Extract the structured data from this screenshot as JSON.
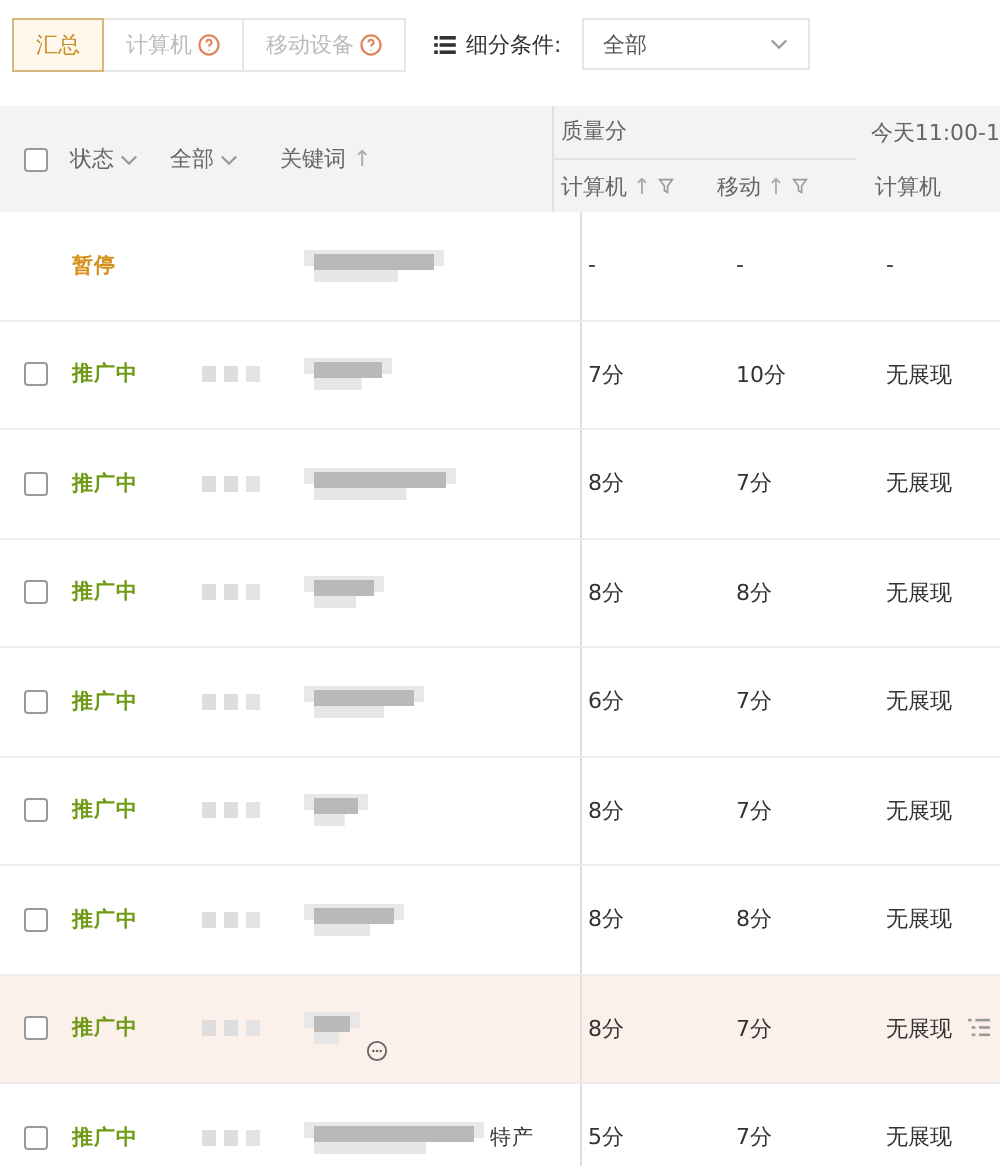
{
  "tabs": [
    {
      "label": "汇总",
      "selected": true,
      "help": false
    },
    {
      "label": "计算机",
      "selected": false,
      "help": true
    },
    {
      "label": "移动设备",
      "selected": false,
      "help": true
    }
  ],
  "filter": {
    "label": "细分条件:",
    "value": "全部"
  },
  "table": {
    "header": {
      "checked": false,
      "status": "状态",
      "scope": "全部",
      "keyword": "关键词",
      "keyword_sort": "↑",
      "group_1": "质量分",
      "group_2": "今天11:00-1",
      "columns": [
        {
          "label": "计算机",
          "sort": "↑",
          "filter": true
        },
        {
          "label": "移动",
          "sort": "↑",
          "filter": true
        },
        {
          "label": "计算机",
          "filter": false
        }
      ]
    },
    "rows": [
      {
        "kind": "paused",
        "status": "暂停",
        "computer": "-",
        "mobile": "-",
        "today": "-",
        "highlighted": false
      },
      {
        "kind": "active",
        "status": "推广中",
        "checked": false,
        "computer": "7分",
        "mobile": "10分",
        "today": "无展现",
        "highlighted": false
      },
      {
        "kind": "active",
        "status": "推广中",
        "checked": false,
        "computer": "8分",
        "mobile": "7分",
        "today": "无展现",
        "highlighted": false
      },
      {
        "kind": "active",
        "status": "推广中",
        "checked": false,
        "computer": "8分",
        "mobile": "8分",
        "today": "无展现",
        "highlighted": false
      },
      {
        "kind": "active",
        "status": "推广中",
        "checked": false,
        "computer": "6分",
        "mobile": "7分",
        "today": "无展现",
        "highlighted": false
      },
      {
        "kind": "active",
        "status": "推广中",
        "checked": false,
        "computer": "8分",
        "mobile": "7分",
        "today": "无展现",
        "highlighted": false
      },
      {
        "kind": "active",
        "status": "推广中",
        "checked": false,
        "computer": "8分",
        "mobile": "8分",
        "today": "无展现",
        "highlighted": false
      },
      {
        "kind": "active",
        "status": "推广中",
        "checked": false,
        "computer": "8分",
        "mobile": "7分",
        "today": "无展现",
        "highlighted": true
      },
      {
        "kind": "active",
        "status": "推广中",
        "checked": false,
        "keyword_suffix": "特产",
        "computer": "5分",
        "mobile": "7分",
        "today": "无展现",
        "highlighted": false
      }
    ]
  }
}
